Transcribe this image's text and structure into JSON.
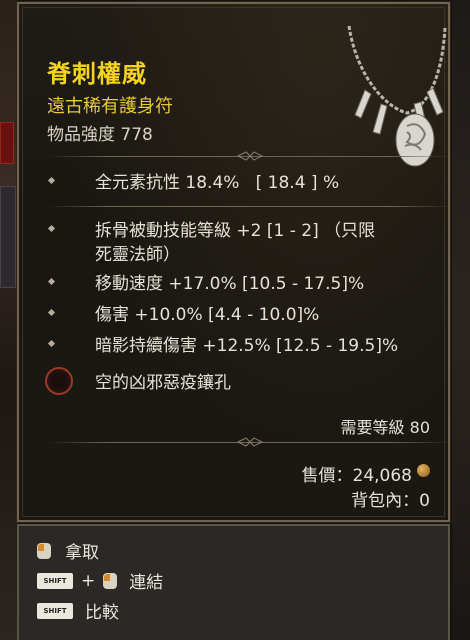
{
  "item": {
    "name": "脊刺權威",
    "type": "遠古稀有護身符",
    "power": "物品強度 778"
  },
  "stats": {
    "implicit": "全元素抗性 18.4%   [ 18.4 ] %",
    "affixes": [
      "拆骨被動技能等級 +2 [1 - 2] （只限\n死靈法師）",
      "移動速度 +17.0% [10.5 - 17.5]%",
      "傷害 +10.0% [4.4 - 10.0]%",
      "暗影持續傷害 +12.5% [12.5 - 19.5]%"
    ],
    "socket": "空的凶邪惡疫鑲孔"
  },
  "requirements": {
    "level": "需要等級 80"
  },
  "sell": {
    "price": "售價：24,068",
    "bag": "背包內：0"
  },
  "actions": {
    "pickup": "拿取",
    "link": "連結",
    "compare": "比較",
    "shift_key": "SHIFT"
  },
  "colors": {
    "legendary_title": "#f5d21c",
    "item_type": "#e9c936",
    "stat_text": "#e6e1d6",
    "border": "#6f6552"
  },
  "icons": {
    "amulet": "bone-amulet-icon",
    "socket": "empty-socket-icon",
    "coin": "gold-coin-icon",
    "mouse": "mouse-button-icon",
    "shift": "shift-key-icon"
  }
}
